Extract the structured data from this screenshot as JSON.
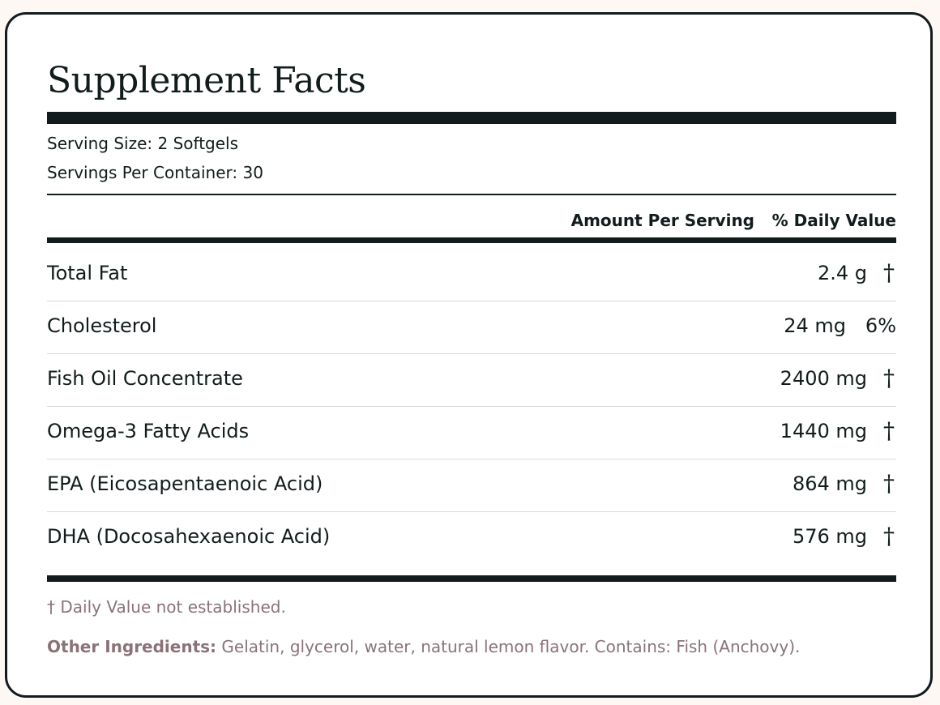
{
  "title": "Supplement Facts",
  "serving": {
    "size": "Serving Size: 2 Softgels",
    "per_container": "Servings Per Container: 30"
  },
  "columns": {
    "amount": "Amount Per Serving",
    "daily_value": "% Daily Value"
  },
  "rows": [
    {
      "name": "Total Fat",
      "amount": "2.4 g",
      "dv": "†"
    },
    {
      "name": "Cholesterol",
      "amount": "24 mg",
      "dv": "6%"
    },
    {
      "name": "Fish Oil Concentrate",
      "amount": "2400 mg",
      "dv": "†"
    },
    {
      "name": "Omega-3 Fatty Acids",
      "amount": "1440 mg",
      "dv": "†"
    },
    {
      "name": "EPA (Eicosapentaenoic Acid)",
      "amount": "864 mg",
      "dv": "†"
    },
    {
      "name": "DHA (Docosahexaenoic Acid)",
      "amount": "576 mg",
      "dv": "†"
    }
  ],
  "footnote": "† Daily Value not established.",
  "ingredients": {
    "label": "Other Ingredients:",
    "text": " Gelatin, glycerol, water, natural lemon flavor. Contains: Fish (Anchovy)."
  },
  "colors": {
    "ink": "#121c1c",
    "muted": "#8a7278",
    "rule": "#d9d9d9",
    "page_background": "#fdf8f4"
  }
}
